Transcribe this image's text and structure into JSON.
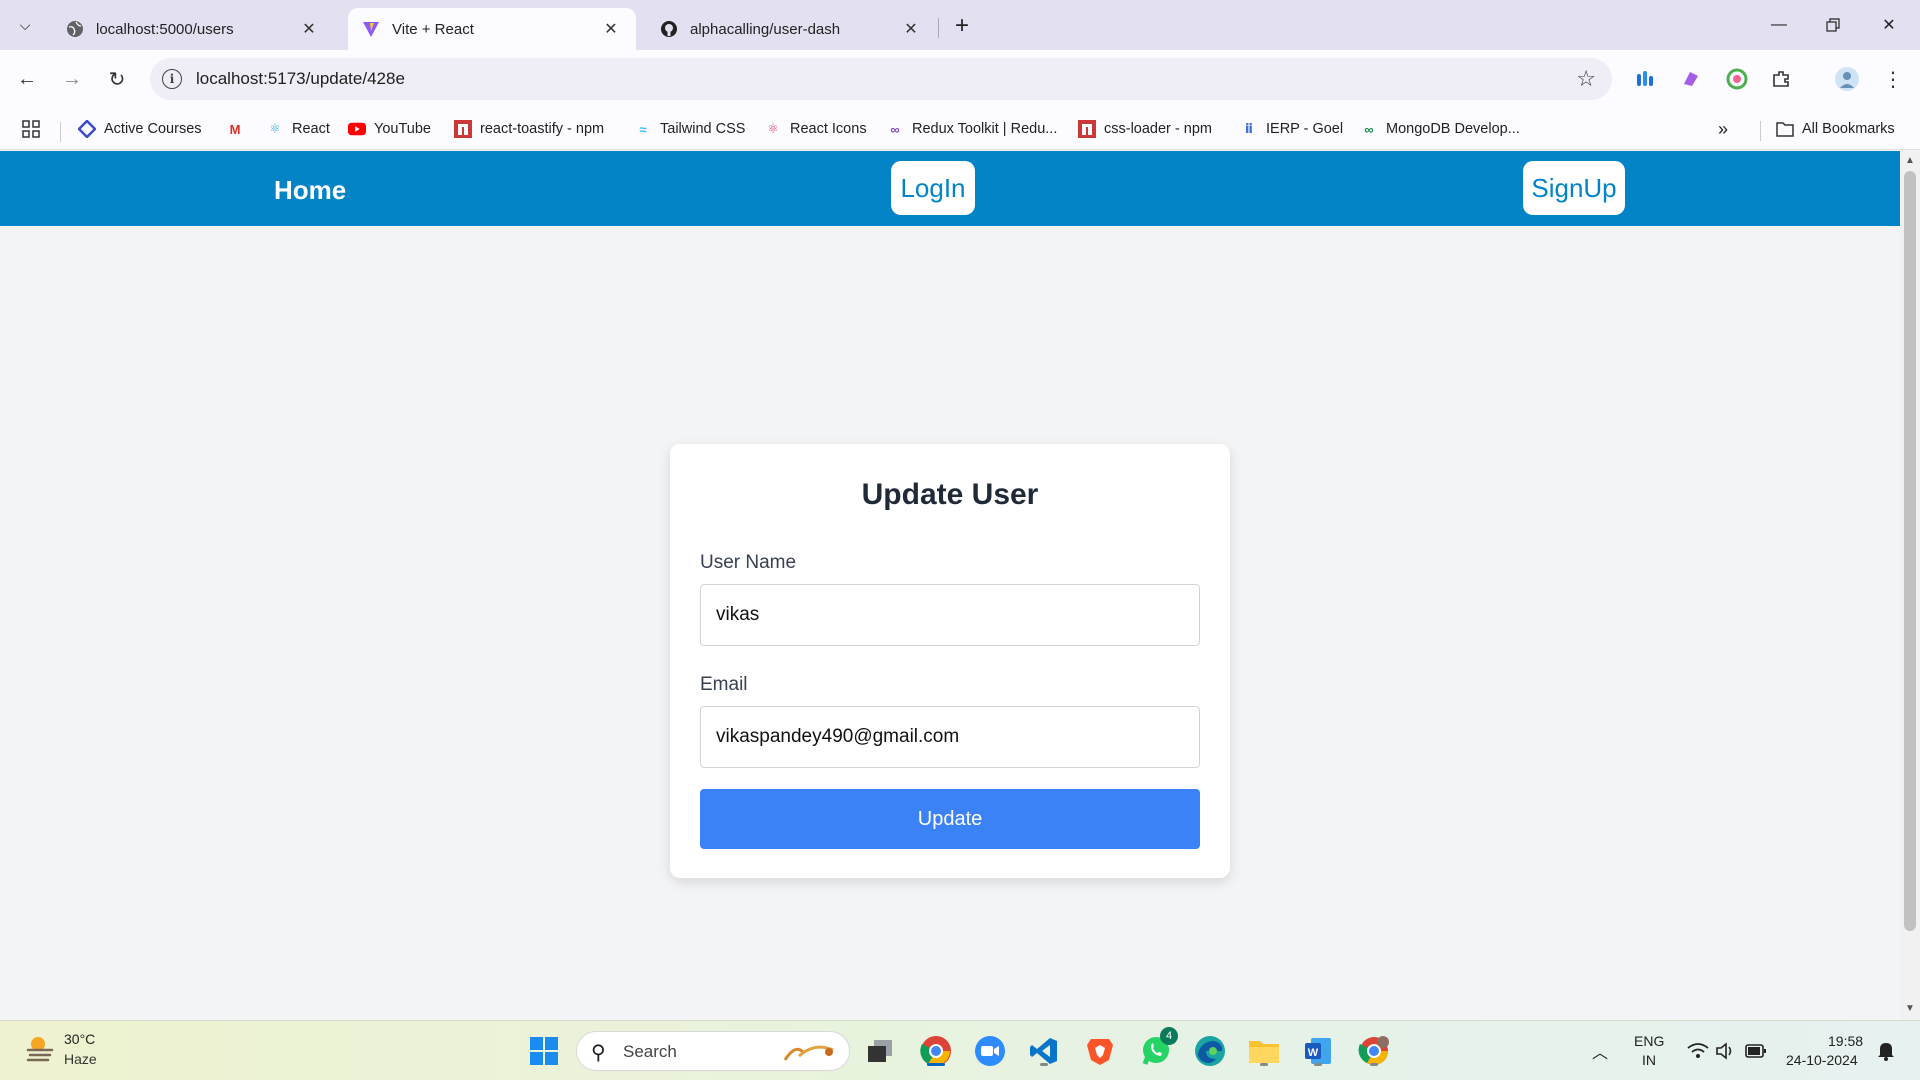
{
  "browser": {
    "tabs": [
      {
        "title": "localhost:5000/users",
        "active": false
      },
      {
        "title": "Vite + React",
        "active": true
      },
      {
        "title": "alphacalling/user-dash",
        "active": false
      }
    ],
    "url": "localhost:5173/update/428e",
    "bookmarks": [
      "Active Courses",
      "React",
      "YouTube",
      "react-toastify - npm",
      "Tailwind CSS",
      "React Icons",
      "Redux Toolkit | Redu...",
      "css-loader - npm",
      "IERP - Goel",
      "MongoDB Develop..."
    ],
    "all_bookmarks_label": "All Bookmarks"
  },
  "navbar": {
    "home": "Home",
    "login": "LogIn",
    "signup": "SignUp"
  },
  "form": {
    "title": "Update User",
    "username_label": "User Name",
    "username_value": "vikas",
    "email_label": "Email",
    "email_value": "vikaspandey490@gmail.com",
    "submit_label": "Update"
  },
  "taskbar": {
    "weather_temp": "30°C",
    "weather_desc": "Haze",
    "search_placeholder": "Search",
    "whatsapp_badge": "4",
    "lang_line1": "ENG",
    "lang_line2": "IN",
    "time": "19:58",
    "date": "24-10-2024"
  },
  "colors": {
    "navbar": "#0284c7",
    "button": "#3b82f6",
    "page_bg": "#f3f4f6"
  }
}
